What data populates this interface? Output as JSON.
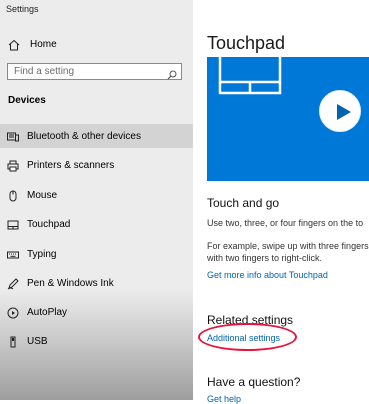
{
  "window": {
    "title": "Settings"
  },
  "sidebar": {
    "home_label": "Home",
    "search_placeholder": "Find a setting",
    "section_label": "Devices",
    "items": [
      {
        "label": "Bluetooth & other devices",
        "icon": "bluetooth-devices-icon",
        "selected": true
      },
      {
        "label": "Printers & scanners",
        "icon": "printer-icon",
        "selected": false
      },
      {
        "label": "Mouse",
        "icon": "mouse-icon",
        "selected": false
      },
      {
        "label": "Touchpad",
        "icon": "touchpad-icon",
        "selected": false
      },
      {
        "label": "Typing",
        "icon": "keyboard-icon",
        "selected": false
      },
      {
        "label": "Pen & Windows Ink",
        "icon": "pen-icon",
        "selected": false
      },
      {
        "label": "AutoPlay",
        "icon": "autoplay-icon",
        "selected": false
      },
      {
        "label": "USB",
        "icon": "usb-icon",
        "selected": false
      }
    ]
  },
  "main": {
    "title": "Touchpad",
    "touch_section": {
      "heading": "Touch and go",
      "line1": "Use two, three, or four fingers on the to",
      "line2": "For example, swipe up with three fingers",
      "line3": "with two fingers to right-click.",
      "link": "Get more info about Touchpad"
    },
    "related": {
      "heading": "Related settings",
      "link": "Additional settings"
    },
    "question": {
      "heading": "Have a question?",
      "link_partial": "Get help"
    }
  },
  "colors": {
    "accent": "#0078d7",
    "link": "#0063b1",
    "annotation_red": "#e8143c",
    "sidebar_bg": "#ececec",
    "selected_bg": "#d3d3d3"
  }
}
